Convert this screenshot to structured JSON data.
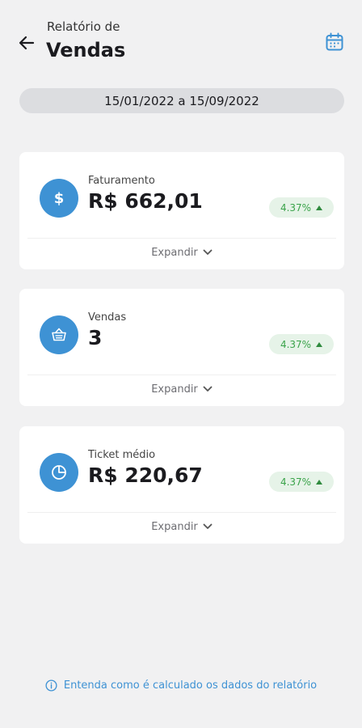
{
  "header": {
    "title_pre": "Relatório de",
    "title_main": "Vendas"
  },
  "date_range": "15/01/2022 a 15/09/2022",
  "cards": [
    {
      "label": "Faturamento",
      "value": "R$ 662,01",
      "badge": "4.37%",
      "expand": "Expandir",
      "icon": "dollar-icon"
    },
    {
      "label": "Vendas",
      "value": "3",
      "badge": "4.37%",
      "expand": "Expandir",
      "icon": "basket-icon"
    },
    {
      "label": "Ticket médio",
      "value": "R$ 220,67",
      "badge": "4.37%",
      "expand": "Expandir",
      "icon": "pie-chart-icon"
    }
  ],
  "footer": {
    "info_link": "Entenda como é calculado os dados do relatório"
  },
  "colors": {
    "accent": "#3e92d4",
    "badge_bg": "#e6f3e8",
    "badge_text": "#3aa34a",
    "background": "#f1f1f2"
  }
}
